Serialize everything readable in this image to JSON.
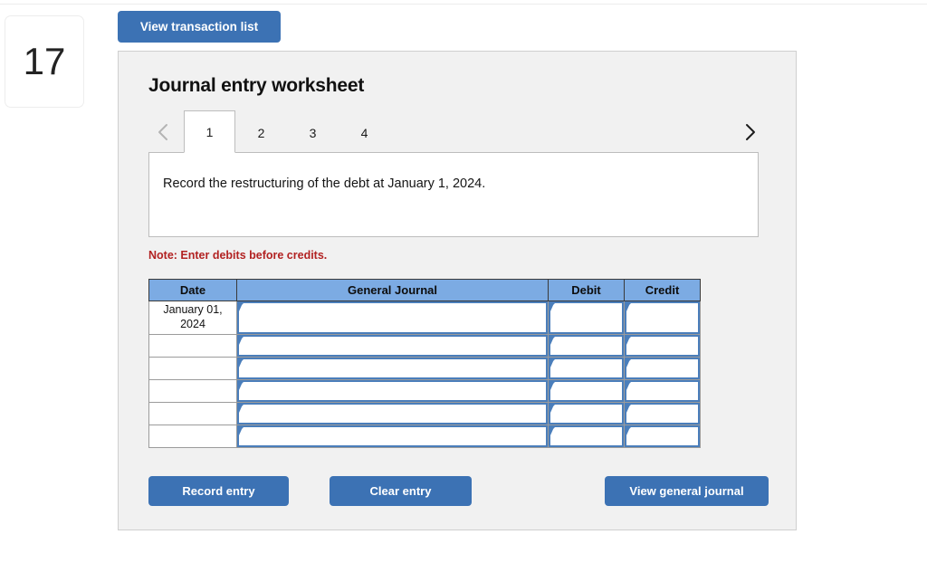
{
  "question_number": "17",
  "toolbar": {
    "view_transaction_list_label": "View transaction list"
  },
  "panel": {
    "title": "Journal entry worksheet",
    "note": "Note: Enter debits before credits.",
    "instruction": "Record the restructuring of the debt at January 1, 2024."
  },
  "nav": {
    "prev_icon": "chevron-left-icon",
    "next_icon": "chevron-right-icon",
    "prev_enabled": false,
    "next_enabled": true
  },
  "tabs": [
    {
      "label": "1",
      "active": true
    },
    {
      "label": "2",
      "active": false
    },
    {
      "label": "3",
      "active": false
    },
    {
      "label": "4",
      "active": false
    }
  ],
  "table": {
    "headers": [
      "Date",
      "General Journal",
      "Debit",
      "Credit"
    ],
    "rows": [
      {
        "date": "January 01, 2024",
        "general_journal": "",
        "debit": "",
        "credit": ""
      },
      {
        "date": "",
        "general_journal": "",
        "debit": "",
        "credit": ""
      },
      {
        "date": "",
        "general_journal": "",
        "debit": "",
        "credit": ""
      },
      {
        "date": "",
        "general_journal": "",
        "debit": "",
        "credit": ""
      },
      {
        "date": "",
        "general_journal": "",
        "debit": "",
        "credit": ""
      },
      {
        "date": "",
        "general_journal": "",
        "debit": "",
        "credit": ""
      }
    ]
  },
  "actions": {
    "record_entry_label": "Record entry",
    "clear_entry_label": "Clear entry",
    "view_general_journal_label": "View general journal"
  },
  "colors": {
    "button_blue": "#3c72b4",
    "header_blue": "#7cabe3",
    "field_border_blue": "#4a7ebb",
    "note_red": "#b22222",
    "panel_bg": "#f1f1f1"
  }
}
